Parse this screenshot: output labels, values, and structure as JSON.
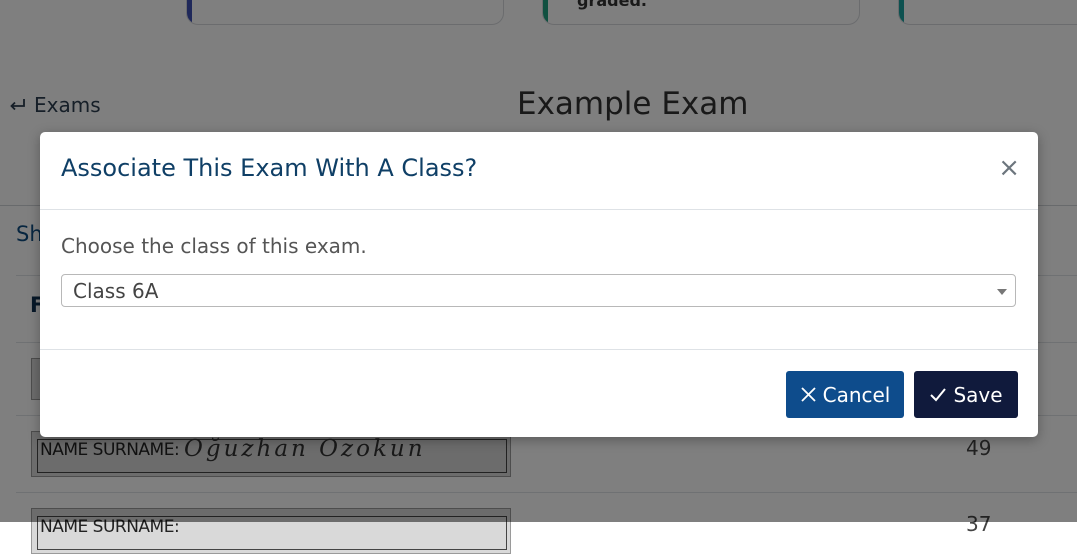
{
  "background": {
    "stat_cards": [
      {
        "text": "",
        "accent": "#3f51b5"
      },
      {
        "text": "graded.",
        "accent": "#20a080"
      },
      {
        "text": "",
        "accent": "#1aa3a0"
      }
    ],
    "back_link": "Exams",
    "page_title": "Example Exam",
    "panel_heading": "Sh",
    "column_heading": "F",
    "rows": [
      {
        "name_label": "NAME SURNAME:",
        "handwriting": "Oğuzhan Özokun",
        "score": "49"
      },
      {
        "name_label": "NAME SURNAME:",
        "handwriting": "",
        "score": "37"
      }
    ]
  },
  "modal": {
    "title": "Associate This Exam With A Class?",
    "close_symbol": "×",
    "prompt": "Choose the class of this exam.",
    "class_select": {
      "selected": "Class 6A"
    },
    "cancel_label": "Cancel",
    "save_label": "Save"
  },
  "colors": {
    "primary": "#0e4c8c",
    "dark": "#101a3c",
    "title": "#0f3f66"
  }
}
